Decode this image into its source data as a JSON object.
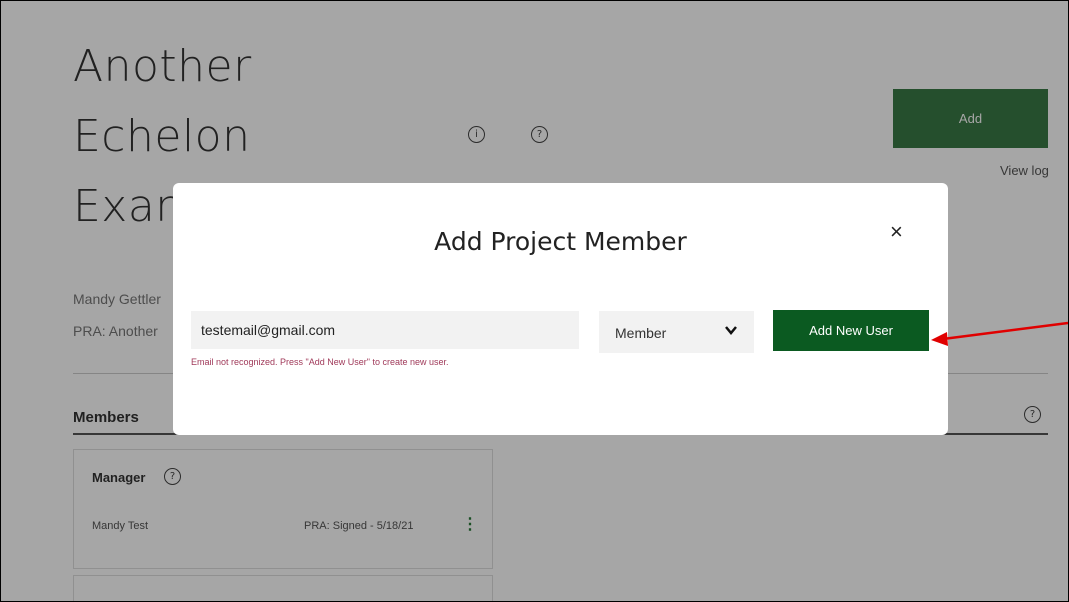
{
  "page": {
    "title_line1": "Another",
    "title_line2": "Echelon",
    "title_line3": "Exan",
    "info_icon": "info-icon",
    "help_icon": "question-icon",
    "add_label": "Add",
    "view_log": "View log",
    "owner": "Mandy Gettler",
    "pra": "PRA: Another",
    "members_title": "Members",
    "manager_label": "Manager",
    "member_name": "Mandy Test",
    "member_status": "PRA: Signed - 5/18/21"
  },
  "modal": {
    "title": "Add Project Member",
    "close_label": "×",
    "email_value": "testemail@gmail.com",
    "error_text": "Email not recognized. Press \"Add New User\" to create new user.",
    "role_selected": "Member",
    "add_new_user_label": "Add New User"
  },
  "colors": {
    "primary_green": "#0b5a21",
    "error": "#a03a5a",
    "annotation_arrow": "#e00000"
  }
}
